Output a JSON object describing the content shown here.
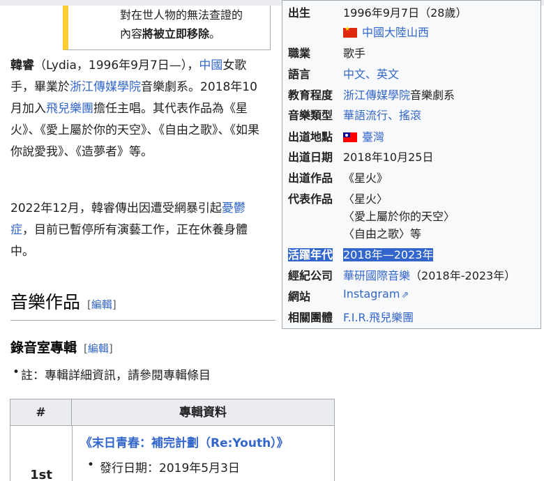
{
  "notice": {
    "line1": "對在世人物的無法查證的",
    "line2_pre": "內容",
    "line2_bold": "將被立即移除",
    "line2_post": "。"
  },
  "intro": {
    "name": "韓睿",
    "paren": "（Lydia，1996年9月7日—），",
    "country": "中國",
    "text1": "女歌手，畢業於",
    "school": "浙江傳媒學院",
    "text2": "音樂劇系。2018年10月加入",
    "band": "飛兒樂團",
    "text3": "擔任主唱。其代表作品為《星火》、《愛上屬於你的天空》、《自由之歌》、《如果你說愛我》、《造夢者》等。"
  },
  "para2": {
    "text1": "2022年12月，韓睿傳出因遭受網暴引起",
    "link": "憂鬱症",
    "text2": "，目前已暫停所有演藝工作，正在休養身體中。"
  },
  "section_music": {
    "title": "音樂作品",
    "edit_open": "[",
    "edit": "編輯",
    "edit_close": "]"
  },
  "section_studio": {
    "title": "錄音室專輯",
    "edit_open": "[",
    "edit": "編輯",
    "edit_close": "]"
  },
  "note": "註：專輯詳細資訊，請參閱專輯條目",
  "albums_table": {
    "col_num": "#",
    "col_info": "專輯資料",
    "rows": [
      {
        "rank": "1st",
        "title_pre": "《",
        "title_link": "末日青春：補完計劃",
        "title_post": "（Re:Youth）》",
        "release": "發行日期：2019年5月3日"
      }
    ]
  },
  "infobox": {
    "birth_label": "出生",
    "birth_date": "1996年9月7日（28歲）",
    "birth_place": "中國大陸山西",
    "occupation_label": "職業",
    "occupation": "歌手",
    "language_label": "語言",
    "lang1": "中文",
    "lang_sep": "、",
    "lang2": "英文",
    "education_label": "教育程度",
    "education_link": "浙江傳媒學院",
    "education_rest": "音樂劇系",
    "genre_label": "音樂類型",
    "genre1": "華語流行",
    "genre_sep": "、",
    "genre2": "搖滾",
    "debut_place_label": "出道地點",
    "debut_place": "臺灣",
    "debut_date_label": "出道日期",
    "debut_date": "2018年10月25日",
    "debut_work_label": "出道作品",
    "debut_work": "《星火》",
    "works_label": "代表作品",
    "work1": "〈星火〉",
    "work2": "〈愛上屬於你的天空〉",
    "work3": "〈自由之歌〉等",
    "active_label": "活躍年代",
    "active": "2018年—2023年",
    "label_label": "經紀公司",
    "label_link": "華研國際音樂",
    "label_rest": "（2018年-2023年）",
    "website_label": "網站",
    "website": "Instagram",
    "related_label": "相關團體",
    "related": "F.I.R.飛兒樂團"
  },
  "colors": {
    "link": "#3366cc",
    "selection": "#3366cc",
    "notice_bar": "#ffcc33",
    "infobox_bg": "#f8f9fa"
  }
}
